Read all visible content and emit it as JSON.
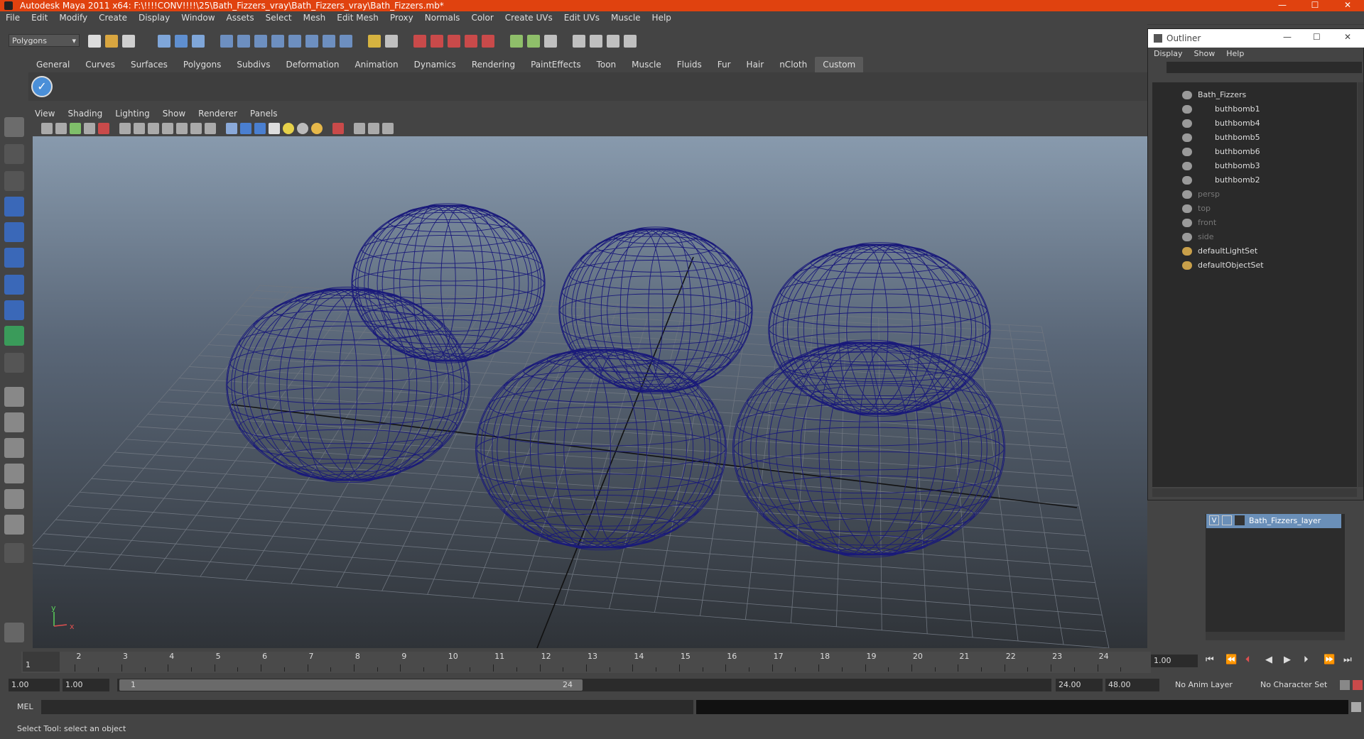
{
  "title_bar": {
    "title": "Autodesk Maya 2011 x64: F:\\!!!!CONV!!!!\\25\\Bath_Fizzers_vray\\Bath_Fizzers_vray\\Bath_Fizzers.mb*",
    "minimize": "—",
    "maximize": "☐",
    "close": "✕"
  },
  "menu_bar": [
    "File",
    "Edit",
    "Modify",
    "Create",
    "Display",
    "Window",
    "Assets",
    "Select",
    "Mesh",
    "Edit Mesh",
    "Proxy",
    "Normals",
    "Color",
    "Create UVs",
    "Edit UVs",
    "Muscle",
    "Help"
  ],
  "status_line": {
    "mode": "Polygons",
    "mode_arrow": "▾"
  },
  "shelf_tabs": [
    "General",
    "Curves",
    "Surfaces",
    "Polygons",
    "Subdivs",
    "Deformation",
    "Animation",
    "Dynamics",
    "Rendering",
    "PaintEffects",
    "Toon",
    "Muscle",
    "Fluids",
    "Fur",
    "Hair",
    "nCloth",
    "Custom"
  ],
  "shelf_active_tab": "Custom",
  "viewport_menu": [
    "View",
    "Shading",
    "Lighting",
    "Show",
    "Renderer",
    "Panels"
  ],
  "viewport": {
    "wire_color": "#1a1a7a",
    "axis_x_label": "x",
    "axis_y_label": "y"
  },
  "outliner": {
    "title": "Outliner",
    "menu": [
      "Display",
      "Show",
      "Help"
    ],
    "items": [
      {
        "label": "Bath_Fizzers",
        "type": "group",
        "dim": false
      },
      {
        "label": "buthbomb1",
        "type": "mesh",
        "dim": false
      },
      {
        "label": "buthbomb4",
        "type": "mesh",
        "dim": false
      },
      {
        "label": "buthbomb5",
        "type": "mesh",
        "dim": false
      },
      {
        "label": "buthbomb6",
        "type": "mesh",
        "dim": false
      },
      {
        "label": "buthbomb3",
        "type": "mesh",
        "dim": false
      },
      {
        "label": "buthbomb2",
        "type": "mesh",
        "dim": false
      },
      {
        "label": "persp",
        "type": "camera",
        "dim": true
      },
      {
        "label": "top",
        "type": "camera",
        "dim": true
      },
      {
        "label": "front",
        "type": "camera",
        "dim": true
      },
      {
        "label": "side",
        "type": "camera",
        "dim": true
      },
      {
        "label": "defaultLightSet",
        "type": "set",
        "dim": false
      },
      {
        "label": "defaultObjectSet",
        "type": "set",
        "dim": false
      }
    ]
  },
  "layer_panel": {
    "layer_visible": "V",
    "layer_name": "Bath_Fizzers_layer"
  },
  "time_slider": {
    "ticks": [
      "1",
      "2",
      "3",
      "4",
      "5",
      "6",
      "7",
      "8",
      "9",
      "10",
      "11",
      "12",
      "13",
      "14",
      "15",
      "16",
      "17",
      "18",
      "19",
      "20",
      "21",
      "22",
      "23",
      "24"
    ],
    "current_frame": "1",
    "current_time_field": "1.00"
  },
  "playback_buttons": [
    "⏮",
    "⏪",
    "⏴",
    "◀",
    "▶",
    "⏵",
    "⏩",
    "⏭"
  ],
  "range_slider": {
    "start_time": "1.00",
    "playback_start": "1.00",
    "range_start_label": "1",
    "range_end_label": "24",
    "playback_end": "24.00",
    "end_time": "48.00",
    "anim_layer": "No Anim Layer",
    "character_set": "No Character Set"
  },
  "command_line": {
    "label": "MEL"
  },
  "help_line": {
    "text": "Select Tool: select an object"
  }
}
